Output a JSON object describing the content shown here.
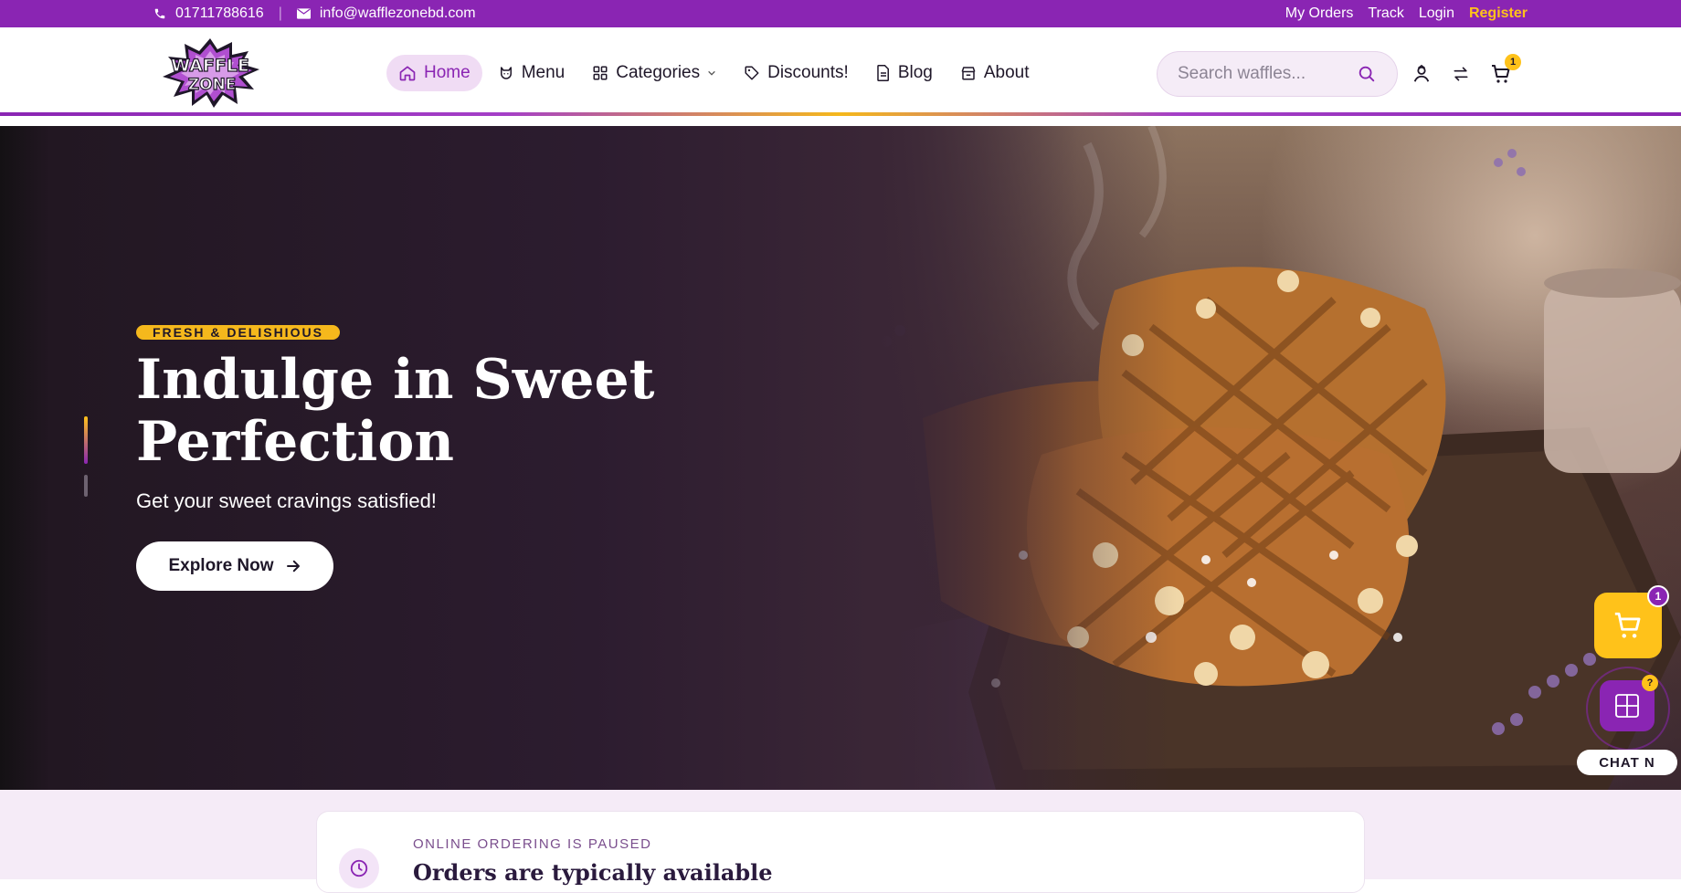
{
  "topbar": {
    "phone": "01711788616",
    "email": "info@wafflezonebd.com",
    "links": [
      "My Orders",
      "Track",
      "Login"
    ],
    "register": "Register"
  },
  "brand": {
    "logo_text_1": "WAFFLE",
    "logo_text_2": "ZONE"
  },
  "nav": [
    {
      "label": "Home",
      "icon": "home-icon",
      "active": true
    },
    {
      "label": "Menu",
      "icon": "cat-icon"
    },
    {
      "label": "Categories",
      "icon": "grid-icon"
    },
    {
      "label": "Discounts!",
      "icon": "tag-icon"
    },
    {
      "label": "Blog",
      "icon": "document-icon"
    },
    {
      "label": "About",
      "icon": "store-icon"
    }
  ],
  "search": {
    "placeholder": "Search waffles..."
  },
  "header_icons": {
    "cart_count": "1"
  },
  "hero": {
    "tag": "FRESH & DELISHIOUS",
    "title": "Indulge in Sweet Perfection",
    "subtitle": "Get your sweet cravings satisfied!",
    "cta": "Explore Now"
  },
  "floating": {
    "cart_count": "1",
    "chat_badge": "?",
    "chat_label": "CHAT N"
  },
  "notice": {
    "kicker": "ONLINE ORDERING IS PAUSED",
    "title": "Orders are typically available"
  },
  "colors": {
    "brand_purple": "#8a25b3",
    "accent_yellow": "#ffc21a",
    "hero_dark": "#2c1c2f"
  }
}
